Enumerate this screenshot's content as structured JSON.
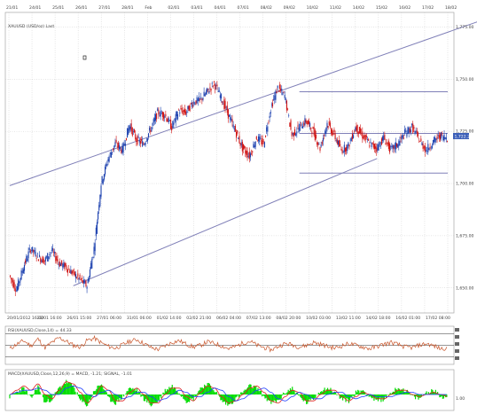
{
  "chart_data": {
    "type": "line",
    "price_panel": {
      "title": "XAUUSD (USD/oz) Last",
      "top_date_labels": [
        "21/01",
        "24/01",
        "25/01",
        "26/01",
        "27/01",
        "28/01",
        "Feb",
        "02/01",
        "03/01",
        "04/01",
        "07/01",
        "08/02",
        "09/02",
        "10/02",
        "11/02",
        "14/02",
        "15/02",
        "16/02",
        "17/02",
        "18/02"
      ],
      "bottom_date_labels": [
        "20/01/2012 16:00",
        "23/01 16:00",
        "26/01 15:00",
        "27/01 06:00",
        "31/01 06:00",
        "01/02 14:00",
        "02/02 21:00",
        "06/02 04:00",
        "07/02 13:00",
        "08/02 20:00",
        "10/02 03:00",
        "13/02 11:00",
        "14/02 18:00",
        "16/02 01:00",
        "17/02 08:00"
      ],
      "y_ticks": [
        1775,
        1750,
        1725,
        1700,
        1675,
        1650
      ],
      "y_tick_labels": [
        "1,775.00",
        "1,750.00",
        "1,725.00",
        "1,700.00",
        "1,675.00",
        "1,650.00"
      ],
      "ylim": [
        1638,
        1782
      ],
      "last_value": 1722.25,
      "last_value_label": "1,722.25",
      "close": [
        1656,
        1649,
        1660,
        1669,
        1665,
        1663,
        1668,
        1662,
        1660,
        1657,
        1654,
        1651,
        1669,
        1700,
        1712,
        1719,
        1716,
        1728,
        1721,
        1719,
        1726,
        1734,
        1733,
        1727,
        1735,
        1734,
        1739,
        1740,
        1744,
        1748,
        1741,
        1733,
        1725,
        1717,
        1713,
        1722,
        1719,
        1736,
        1746,
        1742,
        1723,
        1727,
        1730,
        1725,
        1717,
        1729,
        1723,
        1716,
        1718,
        1727,
        1723,
        1719,
        1717,
        1722,
        1716,
        1719,
        1724,
        1727,
        1721,
        1716,
        1720,
        1723,
        1722
      ],
      "channel_lines": [
        {
          "x": [
            0,
            70
          ],
          "y": [
            1699,
            1782
          ]
        },
        {
          "x": [
            9,
            52
          ],
          "y": [
            1651,
            1712
          ]
        }
      ],
      "horizontal_lines": [
        {
          "x": [
            41,
            62
          ],
          "y": 1744
        },
        {
          "x": [
            41,
            62
          ],
          "y": 1724
        },
        {
          "x": [
            41,
            62
          ],
          "y": 1705
        }
      ],
      "colors": {
        "up": "#1a3fae",
        "down": "#d01414",
        "channel": "#8080b8",
        "grid": "#bfbfbf"
      }
    },
    "rsi_panel": {
      "title": "RSI(XAUUSD,Close,14) = 44.33",
      "levels": [
        70,
        50,
        30
      ],
      "values": [
        44,
        52,
        58,
        49,
        61,
        46,
        55,
        63,
        57,
        50,
        47,
        59,
        62,
        54,
        48,
        45,
        51,
        57,
        60,
        53,
        46,
        43,
        49,
        55,
        58,
        52,
        47,
        50,
        56,
        53,
        49,
        44,
        48,
        54,
        57,
        50,
        46,
        42,
        48,
        53,
        51,
        47,
        50,
        55,
        52,
        48,
        45,
        49,
        53,
        50,
        47,
        44,
        48,
        52,
        55,
        51,
        47,
        46,
        50,
        53,
        49,
        44,
        46
      ],
      "ylim": [
        20,
        80
      ],
      "color": "#c8552a"
    },
    "macd_panel": {
      "title": "MACD(XAUUSD,Close,12,26,9) = MACD, -1.21; SIGNAL, -1.01",
      "histogram": [
        -1,
        1,
        3,
        -2,
        4,
        -4,
        -2,
        3,
        6,
        4,
        -3,
        -5,
        2,
        5,
        -2,
        -4,
        -1,
        3,
        2,
        -2,
        -5,
        -3,
        2,
        4,
        1,
        -3,
        -2,
        3,
        5,
        2,
        -3,
        -5,
        -2,
        1,
        4,
        3,
        -1,
        -4,
        -3,
        1,
        3,
        -1,
        -4,
        -2,
        2,
        3,
        1,
        -2,
        -3,
        1,
        2,
        -1,
        -3,
        -2,
        1,
        3,
        2,
        -1,
        -2,
        1,
        2,
        -1,
        -1
      ],
      "macd": [
        0,
        2,
        4,
        2,
        5,
        0,
        -2,
        2,
        6,
        5,
        1,
        -4,
        -1,
        4,
        2,
        -3,
        -3,
        1,
        3,
        0,
        -4,
        -4,
        0,
        3,
        3,
        -1,
        -3,
        1,
        4,
        3,
        -1,
        -4,
        -3,
        0,
        3,
        4,
        1,
        -3,
        -4,
        -1,
        2,
        1,
        -3,
        -3,
        0,
        2,
        2,
        -1,
        -3,
        -1,
        1,
        0,
        -2,
        -2,
        0,
        2,
        2,
        0,
        -1,
        0,
        1,
        0,
        -1
      ],
      "signal": [
        0,
        1,
        2,
        2,
        3,
        2,
        0,
        0,
        3,
        4,
        3,
        0,
        -1,
        1,
        2,
        0,
        -2,
        -1,
        1,
        1,
        -1,
        -3,
        -2,
        0,
        2,
        1,
        -1,
        -1,
        1,
        3,
        2,
        -1,
        -3,
        -2,
        0,
        2,
        3,
        1,
        -2,
        -3,
        -1,
        1,
        0,
        -2,
        -2,
        0,
        1,
        1,
        -1,
        -2,
        -1,
        0,
        -1,
        -1,
        -1,
        0,
        1,
        1,
        0,
        0,
        0,
        0,
        0
      ],
      "y_tick_labels": [
        "1.00"
      ],
      "colors": {
        "histogram": "#00dd00",
        "macd": "#e02020",
        "signal": "#2040ff"
      }
    }
  }
}
